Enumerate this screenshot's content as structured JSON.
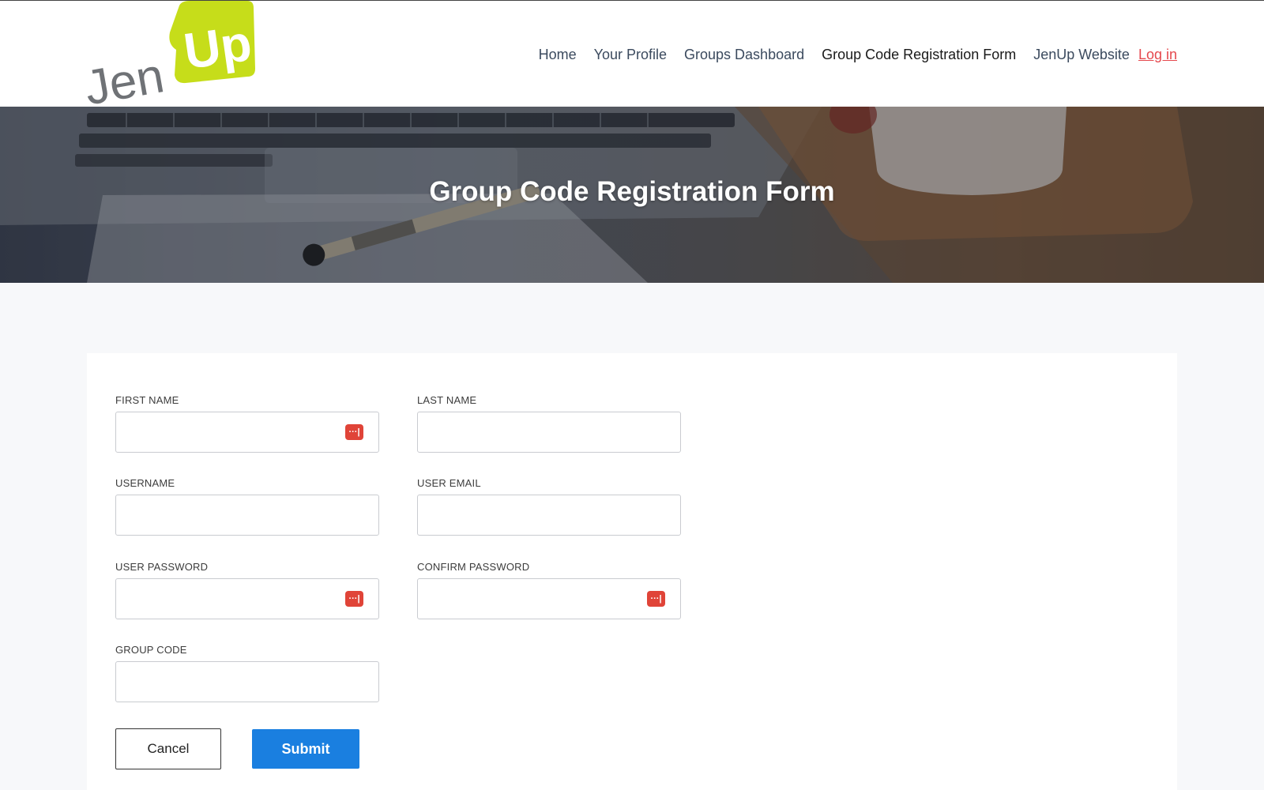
{
  "brand": {
    "logo_text_left": "Jen",
    "logo_text_right": "Up"
  },
  "nav": {
    "items": [
      {
        "label": "Home"
      },
      {
        "label": "Your Profile"
      },
      {
        "label": "Groups Dashboard"
      },
      {
        "label": "Group Code Registration Form"
      },
      {
        "label": "JenUp Website"
      }
    ],
    "login_label": "Log in"
  },
  "hero": {
    "title": "Group Code Registration Form"
  },
  "form": {
    "first_name": {
      "label": "FIRST NAME",
      "value": ""
    },
    "last_name": {
      "label": "LAST NAME",
      "value": ""
    },
    "username": {
      "label": "USERNAME",
      "value": ""
    },
    "user_email": {
      "label": "USER EMAIL",
      "value": ""
    },
    "user_password": {
      "label": "USER PASSWORD",
      "value": ""
    },
    "confirm_password": {
      "label": "CONFIRM PASSWORD",
      "value": ""
    },
    "group_code": {
      "label": "GROUP CODE",
      "value": ""
    },
    "password_manager_icon_glyph": "···|",
    "cancel_label": "Cancel",
    "submit_label": "Submit"
  },
  "colors": {
    "brand_lime": "#c6dd1a",
    "brand_gray": "#6f7276",
    "accent_blue": "#1a7fe0",
    "login_red": "#e5484d",
    "pw_icon_red": "#e04438"
  }
}
